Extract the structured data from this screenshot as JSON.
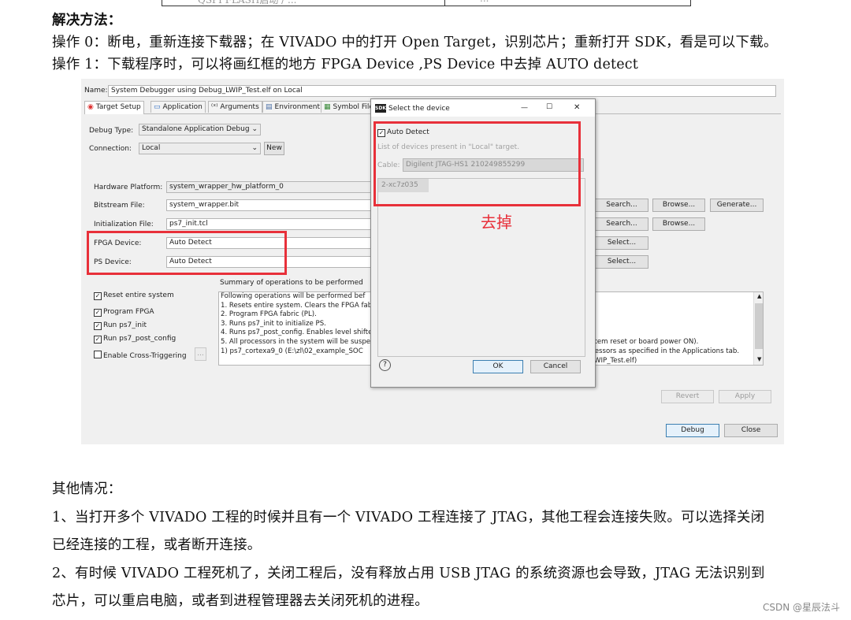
{
  "document": {
    "top_table": {
      "cell1": "QSPI FLASH启动 / ...",
      "cell2": "..."
    },
    "solution_heading": "解决方法：",
    "step0": "操作 0：断电，重新连接下载器；在 VIVADO 中的打开 Open Target，识别芯片；重新打开 SDK，看是可以下载。",
    "step1": "操作 1：下载程序时，可以将画红框的地方 FPGA Device ,PS Device 中去掉  AUTO detect",
    "other_heading": "其他情况：",
    "case1_line1": "1、当打开多个 VIVADO 工程的时候并且有一个 VIVADO 工程连接了 JTAG，其他工程会连接失败。可以选择关闭",
    "case1_line2": "已经连接的工程，或者断开连接。",
    "case2_line1": "2、有时候 VIVADO 工程死机了，关闭工程后，没有释放占用 USB JTAG 的系统资源也会导致，JTAG 无法识别到",
    "case2_line2": "芯片，可以重启电脑，或者到进程管理器去关闭死机的进程。",
    "watermark": "CSDN @星辰法斗"
  },
  "config": {
    "name_label": "Name:",
    "name_value": "System Debugger using Debug_LWIP_Test.elf on Local",
    "tabs": [
      {
        "label": "Target Setup",
        "icon": "target-icon"
      },
      {
        "label": "Application",
        "icon": "application-icon"
      },
      {
        "label": "Arguments",
        "icon": "arguments-icon"
      },
      {
        "label": "Environment",
        "icon": "environment-icon"
      },
      {
        "label": "Symbol File",
        "icon": "symbol-file-icon"
      }
    ],
    "debug_type_label": "Debug Type:",
    "debug_type_value": "Standalone Application Debug",
    "connection_label": "Connection:",
    "connection_value": "Local",
    "new_button": "New",
    "hardware_platform_label": "Hardware Platform:",
    "hardware_platform_value": "system_wrapper_hw_platform_0",
    "bitstream_label": "Bitstream File:",
    "bitstream_value": "system_wrapper.bit",
    "init_label": "Initialization File:",
    "init_value": "ps7_init.tcl",
    "fpga_label": "FPGA Device:",
    "fpga_value": "Auto Detect",
    "ps_label": "PS Device:",
    "ps_value": "Auto Detect",
    "search_button": "Search...",
    "browse_button": "Browse...",
    "generate_button": "Generate...",
    "select_button": "Select...",
    "checkboxes": [
      {
        "label": "Reset entire system",
        "checked": true
      },
      {
        "label": "Program FPGA",
        "checked": true
      },
      {
        "label": "Run ps7_init",
        "checked": true
      },
      {
        "label": "Run ps7_post_config",
        "checked": true
      },
      {
        "label": "Enable Cross-Triggering",
        "checked": false
      }
    ],
    "cross_trigger_button": "...",
    "summary_title": "Summary of operations to be performed",
    "summary_lines": [
      "Following operations will be performed bef",
      "1. Resets entire system. Clears the FPGA fab",
      "2. Program FPGA fabric (PL).",
      "3. Runs ps7_init to initialize PS.",
      "4. Runs ps7_post_config. Enables level shifte",
      "5. All processors in the system will be suspe",
      "   1) ps7_cortexa9_0 (E:\\zl\\02_example_SOC"
    ],
    "summary_right_lines": [
      "stem reset or board power ON).",
      "cessors as specified in the Applications tab.",
      "LWIP_Test.elf)"
    ],
    "revert_button": "Revert",
    "apply_button": "Apply",
    "debug_button": "Debug",
    "close_button": "Close"
  },
  "dialog": {
    "title": "Select the device",
    "app_icon_text": "SDK",
    "auto_detect_label": "Auto Detect",
    "auto_detect_checked": true,
    "list_caption": "List of devices present in \"Local\" target.",
    "cable_label": "Cable:",
    "cable_value": "Digilent JTAG-HS1 210249855299",
    "device_item": "2-xc7z035",
    "ok_button": "OK",
    "cancel_button": "Cancel",
    "help_symbol": "?",
    "minimize_symbol": "—",
    "maximize_symbol": "☐",
    "close_symbol": "✕"
  },
  "annotation": {
    "remove_text": "去掉",
    "color": "#e8303a"
  }
}
